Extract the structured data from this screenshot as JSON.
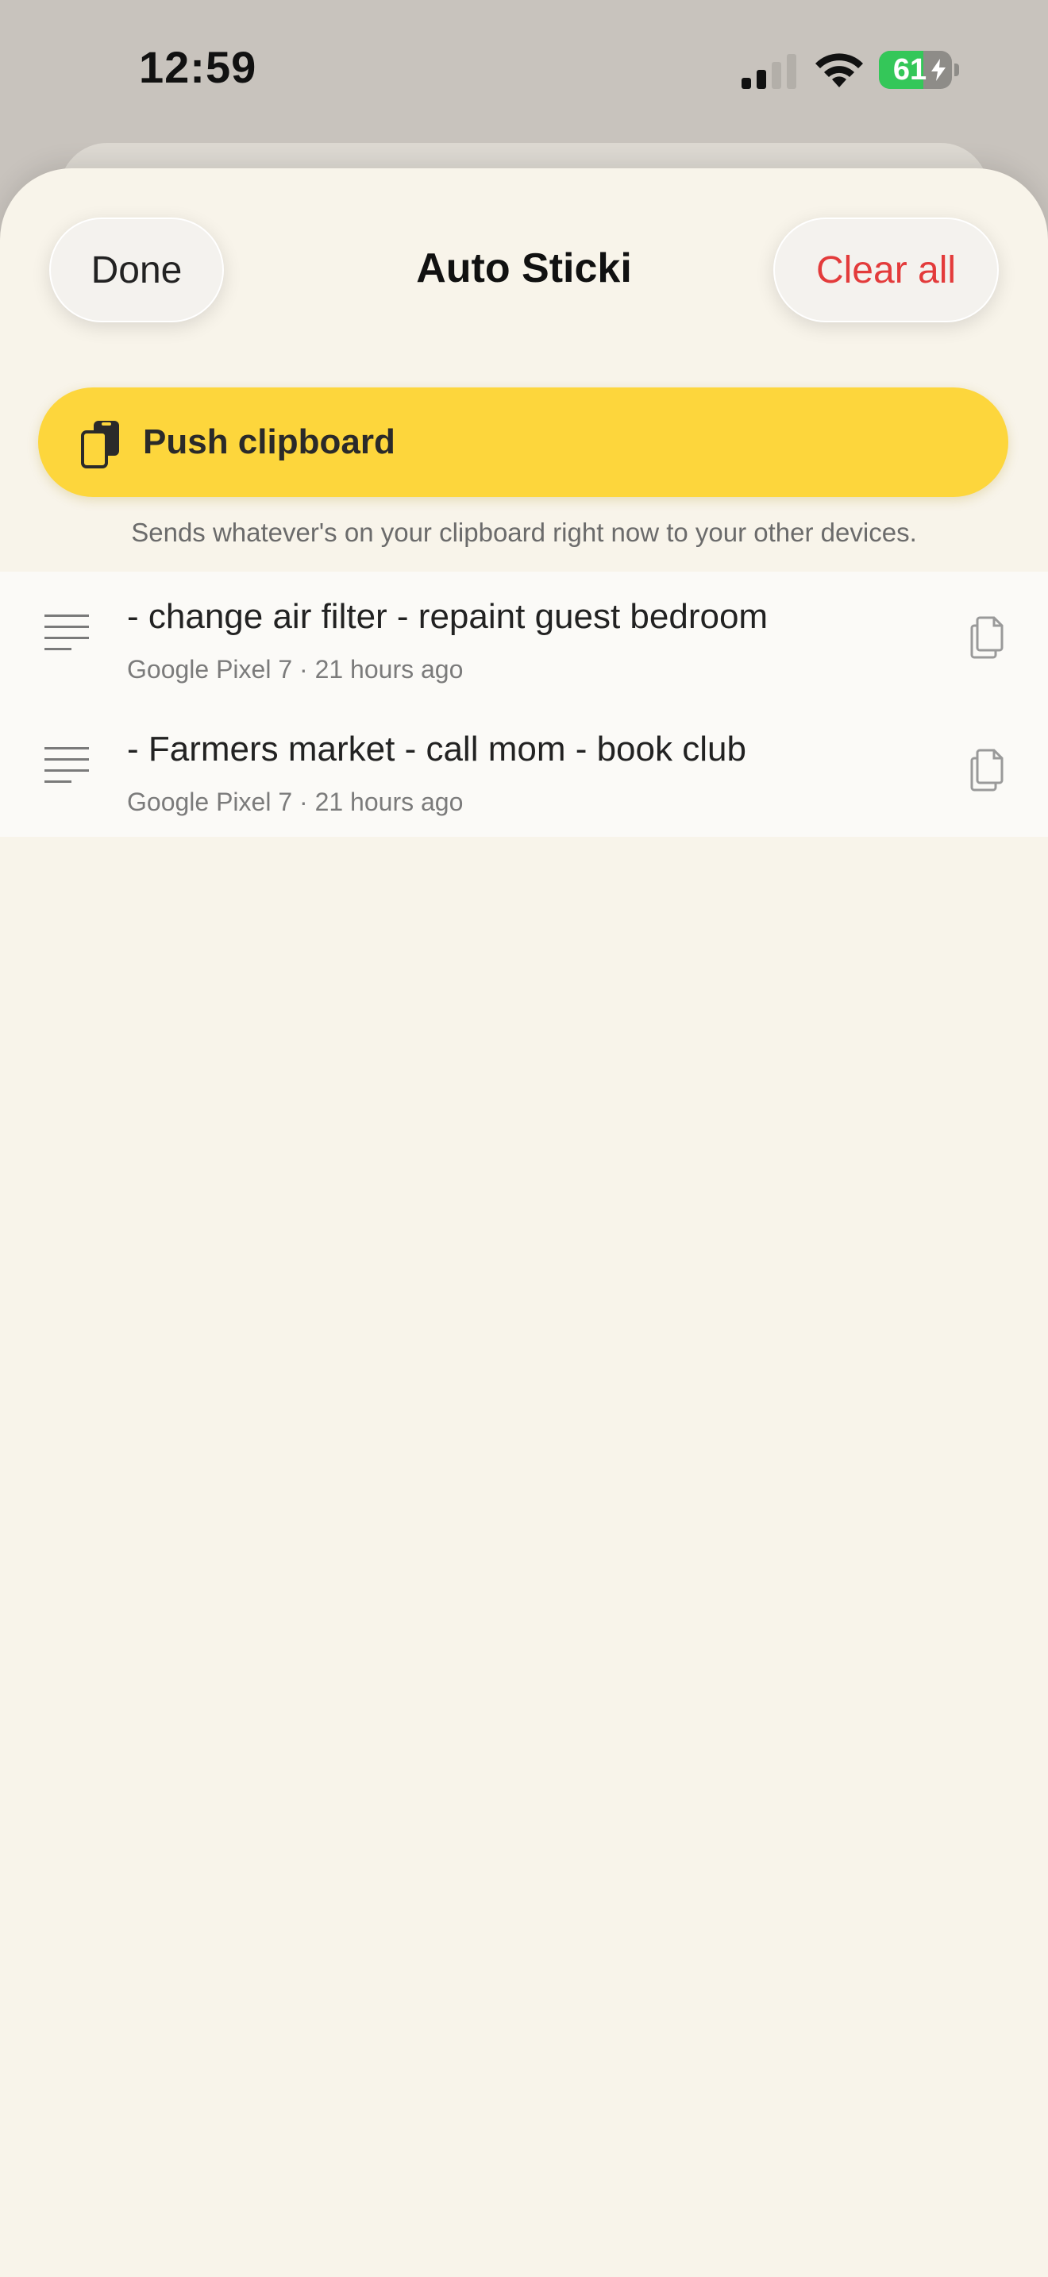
{
  "status_bar": {
    "time": "12:59",
    "battery_level": "61",
    "battery_percent": 61,
    "battery_color": "#34c759"
  },
  "header": {
    "title": "Auto Sticki",
    "done_label": "Done",
    "clear_label": "Clear all",
    "clear_color": "#e33b3b"
  },
  "push": {
    "label": "Push clipboard",
    "icon": "clipboard-phone-icon",
    "hint": "Sends whatever's on your clipboard right now to your other devices.",
    "color": "#fdd63c"
  },
  "items": [
    {
      "text": "- change air filter - repaint guest bedroom",
      "meta": "Google Pixel 7 · 21 hours ago",
      "icon": "text-lines-icon",
      "action_icon": "copy-icon"
    },
    {
      "text": "- Farmers market - call mom - book club",
      "meta": "Google Pixel 7 · 21 hours ago",
      "icon": "text-lines-icon",
      "action_icon": "copy-icon"
    }
  ]
}
